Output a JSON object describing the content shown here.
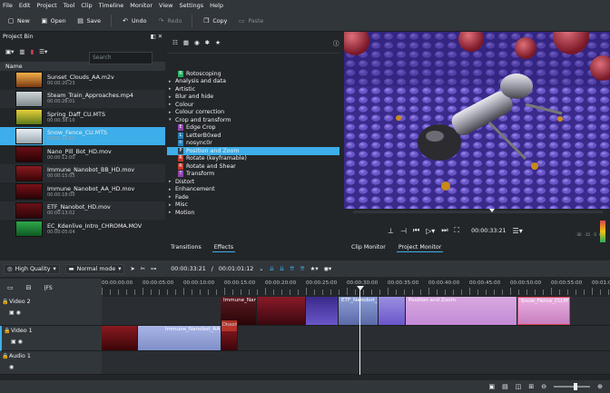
{
  "menu": [
    "File",
    "Edit",
    "Project",
    "Tool",
    "Clip",
    "Timeline",
    "Monitor",
    "View",
    "Settings",
    "Help"
  ],
  "toolbar": {
    "new": "New",
    "open": "Open",
    "save": "Save",
    "undo": "Undo",
    "redo": "Redo",
    "copy": "Copy",
    "paste": "Paste"
  },
  "bin": {
    "title": "Project Bin",
    "search_placeholder": "Search",
    "column": "Name",
    "clips": [
      {
        "name": "Sunset_Clouds_AA.m2v",
        "dur": "00:00:20:23"
      },
      {
        "name": "Steam_Train_Approaches.mp4",
        "dur": "00:00:26:01"
      },
      {
        "name": "Spring_Daff_CU.MTS",
        "dur": "00:00:38:10"
      },
      {
        "name": "Snow_Fence_CU.MTS",
        "dur": "00:00:21:15"
      },
      {
        "name": "Nano_Pill_Bot_HD.mov",
        "dur": "00:00:12:00"
      },
      {
        "name": "Immune_Nanobot_BB_HD.mov",
        "dur": "00:00:15:05"
      },
      {
        "name": "Immune_Nanobot_AA_HD.mov",
        "dur": "00:00:18:00"
      },
      {
        "name": "ETF_Nanobot_HD.mov",
        "dur": "00:00:13:02"
      },
      {
        "name": "EC_Kdenlive_Intro_CHROMA.MOV",
        "dur": "00:00:05:04"
      }
    ]
  },
  "effects": {
    "items": [
      {
        "label": "Rotoscoping",
        "type": "sub",
        "badge": "R",
        "color": "#27ae60"
      },
      {
        "label": "Analysis and data",
        "type": "cat"
      },
      {
        "label": "Artistic",
        "type": "cat"
      },
      {
        "label": "Blur and hide",
        "type": "cat"
      },
      {
        "label": "Colour",
        "type": "cat"
      },
      {
        "label": "Colour correction",
        "type": "cat"
      },
      {
        "label": "Crop and transform",
        "type": "open"
      },
      {
        "label": "Edge Crop",
        "type": "sub",
        "badge": "E",
        "color": "#8e44ad"
      },
      {
        "label": "LetterB0xed",
        "type": "sub",
        "badge": "L",
        "color": "#2980b9"
      },
      {
        "label": "nosync0r",
        "type": "sub",
        "badge": "n",
        "color": "#2980b9"
      },
      {
        "label": "Position and Zoom",
        "type": "sub",
        "badge": "P",
        "color": "#2c3e50",
        "selected": true
      },
      {
        "label": "Rotate (keyframable)",
        "type": "sub",
        "badge": "R",
        "color": "#c0392b"
      },
      {
        "label": "Rotate and Shear",
        "type": "sub",
        "badge": "R",
        "color": "#c0392b"
      },
      {
        "label": "Transform",
        "type": "sub",
        "badge": "T",
        "color": "#8e44ad"
      },
      {
        "label": "Distort",
        "type": "cat"
      },
      {
        "label": "Enhancement",
        "type": "cat"
      },
      {
        "label": "Fade",
        "type": "cat"
      },
      {
        "label": "Misc",
        "type": "cat"
      },
      {
        "label": "Motion",
        "type": "cat"
      }
    ],
    "tabs": [
      "Transitions",
      "Effects"
    ]
  },
  "monitor": {
    "timecode": "00:00:33:21",
    "tabs": [
      "Clip Monitor",
      "Project Monitor"
    ],
    "vu_labels": [
      "-30",
      "-15",
      "-5",
      "0"
    ]
  },
  "timeline": {
    "quality": "High Quality",
    "mode": "Normal mode",
    "position": "00:00:33:21",
    "duration": "00:01:01:12",
    "ruler": [
      "00:00:00:00",
      "00:00:05:00",
      "00:00:10:00",
      "00:00:15:00",
      "00:00:20:00",
      "00:00:25:00",
      "00:00:30:00",
      "00:00:35:00",
      "00:00:40:00",
      "00:00:45:00",
      "00:00:50:00",
      "00:00:55:00",
      "00:01:00:00"
    ],
    "tracks": [
      "Video 2",
      "Video 1",
      "Audio 1"
    ],
    "fps_label": "|FS",
    "clips_v2": [
      {
        "label": "Immune_Nanobot_BB_HD.mov",
        "color": "#5a1a22"
      },
      {
        "label": "ETF_Nanobot_HD.mov",
        "color": "#7a6fc9"
      },
      {
        "label": "Position and Zoom",
        "color": "#b5a2d8"
      },
      {
        "label": "Snow_Fence_CU.MTS",
        "color": "#d87fc0"
      }
    ],
    "clips_v1": [
      {
        "label": "Immune_Nanobot_AA_H",
        "color": "#8d9fd6"
      },
      {
        "label": "Dissolve",
        "color": "#c0392b"
      }
    ]
  }
}
